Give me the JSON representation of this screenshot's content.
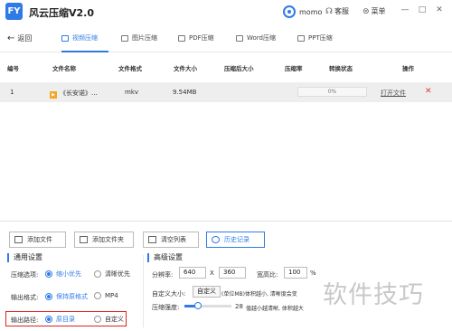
{
  "app": {
    "logo_text": "FY",
    "title": "风云压缩V2.0",
    "username": "momo",
    "service": "客服",
    "menu": "菜单"
  },
  "window": {
    "minimize": "—",
    "maximize": "□",
    "close": "✕"
  },
  "nav": {
    "back": "返回",
    "tabs": [
      {
        "label": "视频压缩",
        "active": true
      },
      {
        "label": "图片压缩",
        "active": false
      },
      {
        "label": "PDF压缩",
        "active": false
      },
      {
        "label": "Word压缩",
        "active": false
      },
      {
        "label": "PPT压缩",
        "active": false
      }
    ]
  },
  "table": {
    "headers": [
      "编号",
      "文件名称",
      "文件格式",
      "文件大小",
      "压缩后大小",
      "压缩率",
      "转换状态",
      "操作"
    ],
    "rows": [
      {
        "index": "1",
        "name": "《长安诺》...",
        "format": "mkv",
        "size": "9.54MB",
        "compressed_size": "",
        "ratio": "",
        "progress_text": "0%",
        "progress": 0,
        "action": "打开文件",
        "delete": "✕"
      }
    ]
  },
  "toolbar": {
    "add_file": "添加文件",
    "add_folder": "添加文件夹",
    "clear_list": "清空列表",
    "history": "历史记录"
  },
  "general": {
    "title": "通用设置",
    "compress_option_label": "压缩选项:",
    "compress_options": [
      {
        "label": "缩小优先",
        "selected": true
      },
      {
        "label": "清晰优先",
        "selected": false
      }
    ],
    "output_format_label": "输出格式:",
    "output_formats": [
      {
        "label": "保持原格式",
        "selected": true
      },
      {
        "label": "MP4",
        "selected": false
      }
    ],
    "output_path_label": "输出路径:",
    "output_paths": [
      {
        "label": "原目录",
        "selected": true
      },
      {
        "label": "自定义",
        "selected": false
      }
    ]
  },
  "advanced": {
    "title": "高级设置",
    "resolution_label": "分辨率:",
    "width": "640",
    "times": "X",
    "height": "360",
    "aspect_label": "宽高比:",
    "aspect_value": "100",
    "aspect_suffix": "%",
    "custom_size_label": "自定义大小:",
    "custom_size_button": "自定义",
    "custom_size_hint": "(单位MB)体积越小, 清晰度会变",
    "strength_label": "压缩强度:",
    "strength_value": "28",
    "strength_hint": "值越小越清晰, 体积越大",
    "strength_level": 0.28
  },
  "watermark": "软件技巧"
}
